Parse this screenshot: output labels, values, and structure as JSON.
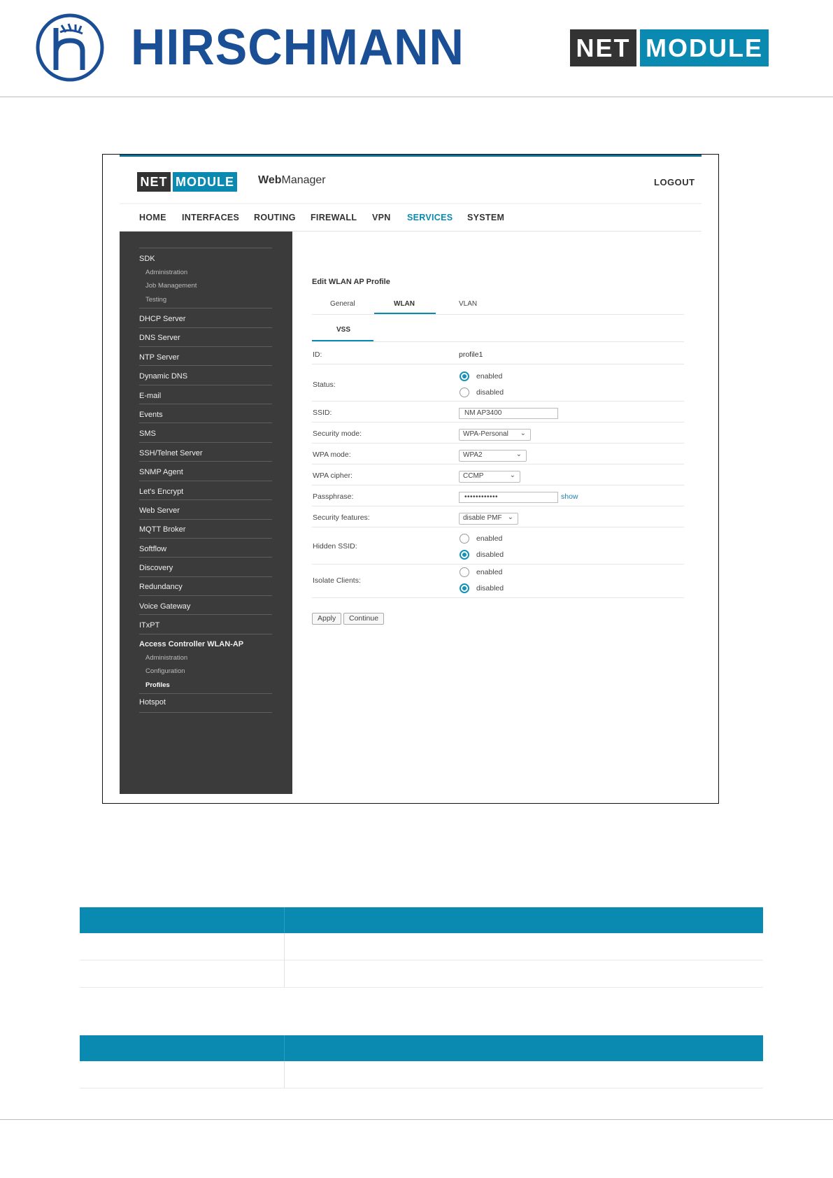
{
  "header": {
    "brand": "HIRSCHMANN",
    "nm_net": "NET",
    "nm_module": "MODULE"
  },
  "app": {
    "logo_net": "NET",
    "logo_module": "MODULE",
    "title_bold": "Web",
    "title_rest": "Manager",
    "logout": "LOGOUT",
    "nav": [
      "HOME",
      "INTERFACES",
      "ROUTING",
      "FIREWALL",
      "VPN",
      "SERVICES",
      "SYSTEM"
    ],
    "nav_active": "SERVICES",
    "sidebar": {
      "sdk": "SDK",
      "sdk_sub": [
        "Administration",
        "Job Management",
        "Testing"
      ],
      "items": [
        "DHCP Server",
        "DNS Server",
        "NTP Server",
        "Dynamic DNS",
        "E-mail",
        "Events",
        "SMS",
        "SSH/Telnet Server",
        "SNMP Agent",
        "Let's Encrypt",
        "Web Server",
        "MQTT Broker",
        "Softflow",
        "Discovery",
        "Redundancy",
        "Voice Gateway",
        "ITxPT"
      ],
      "ac": "Access Controller WLAN-AP",
      "ac_sub": [
        "Administration",
        "Configuration",
        "Profiles"
      ],
      "hotspot": "Hotspot"
    },
    "content": {
      "title": "Edit WLAN AP Profile",
      "tabs": [
        "General",
        "WLAN",
        "VLAN"
      ],
      "subtab": "VSS",
      "fields": {
        "id_label": "ID:",
        "id_value": "profile1",
        "status_label": "Status:",
        "enabled": "enabled",
        "disabled": "disabled",
        "ssid_label": "SSID:",
        "ssid_value": "NM AP3400",
        "secmode_label": "Security mode:",
        "secmode_value": "WPA-Personal",
        "wpamode_label": "WPA mode:",
        "wpamode_value": "WPA2",
        "cipher_label": "WPA cipher:",
        "cipher_value": "CCMP",
        "pass_label": "Passphrase:",
        "pass_value": "••••••••••••",
        "show": "show",
        "secfeat_label": "Security features:",
        "secfeat_value": "disable PMF",
        "hidden_label": "Hidden SSID:",
        "isolate_label": "Isolate Clients:"
      },
      "apply": "Apply",
      "continue": "Continue"
    }
  }
}
